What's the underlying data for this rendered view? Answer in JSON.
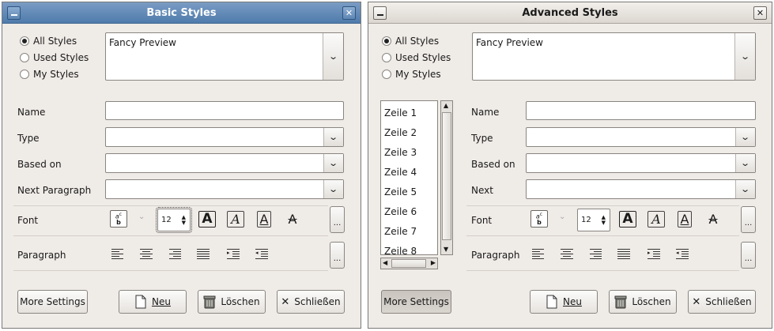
{
  "basic": {
    "title": "Basic Styles",
    "radios": [
      "All Styles",
      "Used Styles",
      "My Styles"
    ],
    "preview_text": "Fancy Preview",
    "labels": {
      "name": "Name",
      "type": "Type",
      "based_on": "Based on",
      "next": "Next Paragraph",
      "font": "Font",
      "paragraph": "Paragraph"
    },
    "font_size": "12",
    "ellipsis": "...",
    "buttons": {
      "more": "More Settings",
      "neu": "Neu",
      "loeschen": "Löschen",
      "schliessen": "Schließen"
    }
  },
  "advanced": {
    "title": "Advanced Styles",
    "radios": [
      "All Styles",
      "Used Styles",
      "My Styles"
    ],
    "preview_text": "Fancy Preview",
    "list": [
      "Zeile 1",
      "Zeile 2",
      "Zeile 3",
      "Zeile 4",
      "Zeile 5",
      "Zeile 6",
      "Zeile 7",
      "Zeile 8"
    ],
    "labels": {
      "name": "Name",
      "type": "Type",
      "based_on": "Based on",
      "next": "Next",
      "font": "Font",
      "paragraph": "Paragraph"
    },
    "font_size": "12",
    "ellipsis": "...",
    "buttons": {
      "more": "More Settings",
      "neu": "Neu",
      "loeschen": "Löschen",
      "schliessen": "Schließen"
    }
  },
  "icons": {
    "minimize": "minimize-icon",
    "close": "close-icon",
    "dropdown": "chevron-down-icon",
    "font_formats": [
      "spell-check-icon",
      "bold-icon",
      "italic-icon",
      "underline-icon",
      "strikethrough-icon"
    ],
    "paragraph_formats": [
      "align-left-icon",
      "align-center-icon",
      "align-right-icon",
      "justify-icon",
      "indent-icon",
      "outdent-icon"
    ],
    "new": "new-document-icon",
    "delete": "trash-icon",
    "close_button": "x-icon"
  }
}
